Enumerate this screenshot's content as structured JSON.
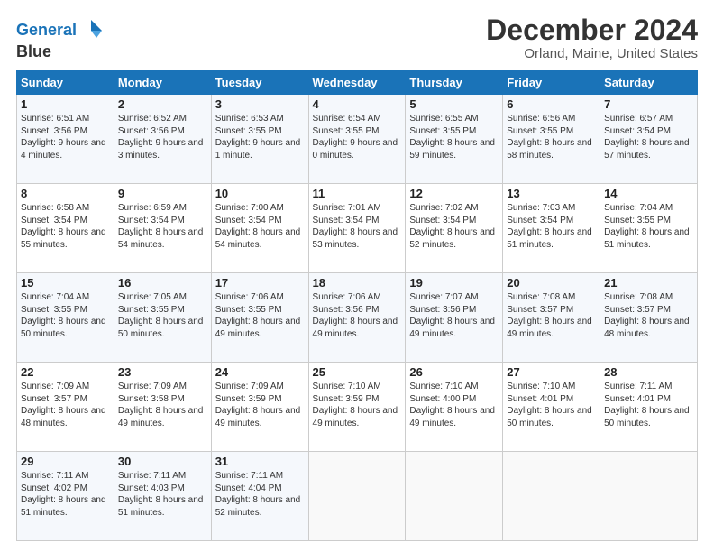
{
  "logo": {
    "line1": "General",
    "line2": "Blue"
  },
  "title": "December 2024",
  "location": "Orland, Maine, United States",
  "days_header": [
    "Sunday",
    "Monday",
    "Tuesday",
    "Wednesday",
    "Thursday",
    "Friday",
    "Saturday"
  ],
  "weeks": [
    [
      {
        "day": "1",
        "sunrise": "6:51 AM",
        "sunset": "3:56 PM",
        "daylight": "9 hours and 4 minutes."
      },
      {
        "day": "2",
        "sunrise": "6:52 AM",
        "sunset": "3:56 PM",
        "daylight": "9 hours and 3 minutes."
      },
      {
        "day": "3",
        "sunrise": "6:53 AM",
        "sunset": "3:55 PM",
        "daylight": "9 hours and 1 minute."
      },
      {
        "day": "4",
        "sunrise": "6:54 AM",
        "sunset": "3:55 PM",
        "daylight": "9 hours and 0 minutes."
      },
      {
        "day": "5",
        "sunrise": "6:55 AM",
        "sunset": "3:55 PM",
        "daylight": "8 hours and 59 minutes."
      },
      {
        "day": "6",
        "sunrise": "6:56 AM",
        "sunset": "3:55 PM",
        "daylight": "8 hours and 58 minutes."
      },
      {
        "day": "7",
        "sunrise": "6:57 AM",
        "sunset": "3:54 PM",
        "daylight": "8 hours and 57 minutes."
      }
    ],
    [
      {
        "day": "8",
        "sunrise": "6:58 AM",
        "sunset": "3:54 PM",
        "daylight": "8 hours and 55 minutes."
      },
      {
        "day": "9",
        "sunrise": "6:59 AM",
        "sunset": "3:54 PM",
        "daylight": "8 hours and 54 minutes."
      },
      {
        "day": "10",
        "sunrise": "7:00 AM",
        "sunset": "3:54 PM",
        "daylight": "8 hours and 54 minutes."
      },
      {
        "day": "11",
        "sunrise": "7:01 AM",
        "sunset": "3:54 PM",
        "daylight": "8 hours and 53 minutes."
      },
      {
        "day": "12",
        "sunrise": "7:02 AM",
        "sunset": "3:54 PM",
        "daylight": "8 hours and 52 minutes."
      },
      {
        "day": "13",
        "sunrise": "7:03 AM",
        "sunset": "3:54 PM",
        "daylight": "8 hours and 51 minutes."
      },
      {
        "day": "14",
        "sunrise": "7:04 AM",
        "sunset": "3:55 PM",
        "daylight": "8 hours and 51 minutes."
      }
    ],
    [
      {
        "day": "15",
        "sunrise": "7:04 AM",
        "sunset": "3:55 PM",
        "daylight": "8 hours and 50 minutes."
      },
      {
        "day": "16",
        "sunrise": "7:05 AM",
        "sunset": "3:55 PM",
        "daylight": "8 hours and 50 minutes."
      },
      {
        "day": "17",
        "sunrise": "7:06 AM",
        "sunset": "3:55 PM",
        "daylight": "8 hours and 49 minutes."
      },
      {
        "day": "18",
        "sunrise": "7:06 AM",
        "sunset": "3:56 PM",
        "daylight": "8 hours and 49 minutes."
      },
      {
        "day": "19",
        "sunrise": "7:07 AM",
        "sunset": "3:56 PM",
        "daylight": "8 hours and 49 minutes."
      },
      {
        "day": "20",
        "sunrise": "7:08 AM",
        "sunset": "3:57 PM",
        "daylight": "8 hours and 49 minutes."
      },
      {
        "day": "21",
        "sunrise": "7:08 AM",
        "sunset": "3:57 PM",
        "daylight": "8 hours and 48 minutes."
      }
    ],
    [
      {
        "day": "22",
        "sunrise": "7:09 AM",
        "sunset": "3:57 PM",
        "daylight": "8 hours and 48 minutes."
      },
      {
        "day": "23",
        "sunrise": "7:09 AM",
        "sunset": "3:58 PM",
        "daylight": "8 hours and 49 minutes."
      },
      {
        "day": "24",
        "sunrise": "7:09 AM",
        "sunset": "3:59 PM",
        "daylight": "8 hours and 49 minutes."
      },
      {
        "day": "25",
        "sunrise": "7:10 AM",
        "sunset": "3:59 PM",
        "daylight": "8 hours and 49 minutes."
      },
      {
        "day": "26",
        "sunrise": "7:10 AM",
        "sunset": "4:00 PM",
        "daylight": "8 hours and 49 minutes."
      },
      {
        "day": "27",
        "sunrise": "7:10 AM",
        "sunset": "4:01 PM",
        "daylight": "8 hours and 50 minutes."
      },
      {
        "day": "28",
        "sunrise": "7:11 AM",
        "sunset": "4:01 PM",
        "daylight": "8 hours and 50 minutes."
      }
    ],
    [
      {
        "day": "29",
        "sunrise": "7:11 AM",
        "sunset": "4:02 PM",
        "daylight": "8 hours and 51 minutes."
      },
      {
        "day": "30",
        "sunrise": "7:11 AM",
        "sunset": "4:03 PM",
        "daylight": "8 hours and 51 minutes."
      },
      {
        "day": "31",
        "sunrise": "7:11 AM",
        "sunset": "4:04 PM",
        "daylight": "8 hours and 52 minutes."
      },
      null,
      null,
      null,
      null
    ]
  ]
}
